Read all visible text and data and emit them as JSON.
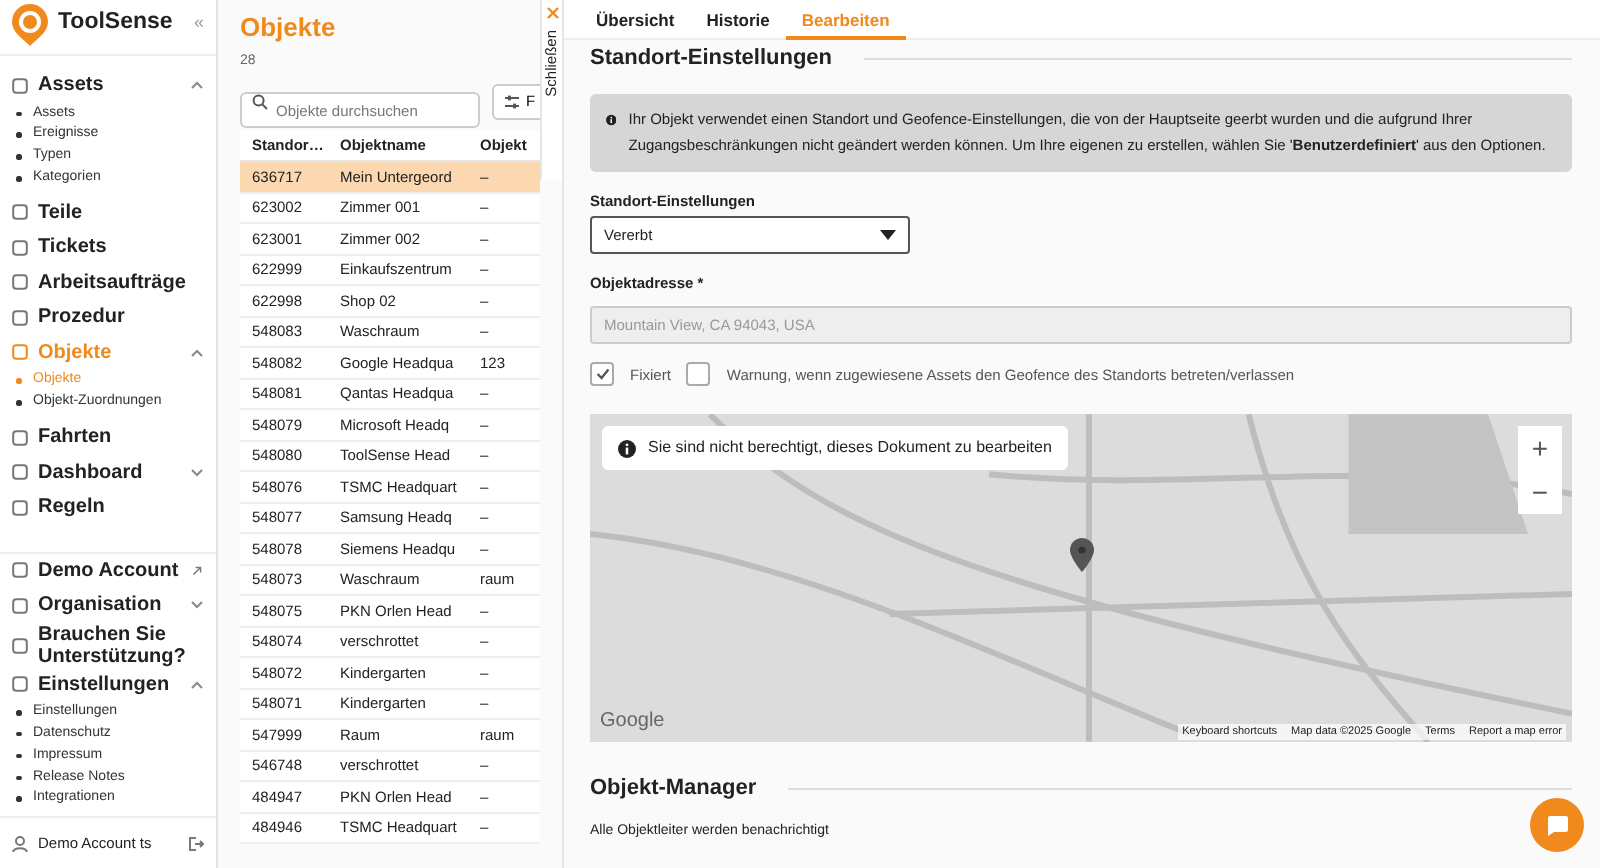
{
  "sidebar": {
    "brand": "ToolSense",
    "collapse_glyph": "«",
    "items": [
      {
        "label": "Assets",
        "selected": false,
        "expanded": true,
        "children": [
          {
            "label": "Assets",
            "selected": false
          },
          {
            "label": "Ereignisse",
            "selected": false
          },
          {
            "label": "Typen",
            "selected": false
          },
          {
            "label": "Kategorien",
            "selected": false
          }
        ]
      },
      {
        "label": "Teile",
        "selected": false
      },
      {
        "label": "Tickets",
        "selected": false
      },
      {
        "label": "Arbeitsaufträge",
        "selected": false
      },
      {
        "label": "Prozedur",
        "selected": false
      },
      {
        "label": "Objekte",
        "selected": true,
        "expanded": true,
        "children": [
          {
            "label": "Objekte",
            "selected": true
          },
          {
            "label": "Objekt-Zuordnungen",
            "selected": false
          }
        ]
      },
      {
        "label": "Fahrten",
        "selected": false
      },
      {
        "label": "Dashboard",
        "selected": false,
        "expanded": false
      },
      {
        "label": "Regeln",
        "selected": false
      }
    ],
    "bottom_items": [
      {
        "label": "Demo Account",
        "selected": false,
        "external": true
      },
      {
        "label": "Organisation",
        "selected": false,
        "expanded": false
      },
      {
        "label": "Brauchen Sie Unterstützung?",
        "selected": false
      },
      {
        "label": "Einstellungen",
        "selected": false,
        "expanded": true,
        "children": [
          {
            "label": "Einstellungen",
            "selected": false
          },
          {
            "label": "Datenschutz",
            "selected": false
          },
          {
            "label": "Impressum",
            "selected": false
          },
          {
            "label": "Release Notes",
            "selected": false
          },
          {
            "label": "Integrationen",
            "selected": false
          }
        ]
      }
    ],
    "user": "Demo Account ts"
  },
  "list_panel": {
    "title": "Objekte",
    "count": "28",
    "search": {
      "placeholder": "Objekte durchsuchen"
    },
    "filter_button": "F",
    "close_tab": "Schließen",
    "table": {
      "columns": [
        "Standor…",
        "Objektname",
        "Objekt"
      ],
      "rows": [
        {
          "cells": [
            "636717",
            "Mein Untergeord",
            "–"
          ],
          "selected": true
        },
        {
          "cells": [
            "623002",
            "Zimmer 001",
            "–"
          ],
          "selected": false
        },
        {
          "cells": [
            "623001",
            "Zimmer 002",
            "–"
          ],
          "selected": false
        },
        {
          "cells": [
            "622999",
            "Einkaufszentrum",
            "–"
          ],
          "selected": false
        },
        {
          "cells": [
            "622998",
            "Shop 02",
            "–"
          ],
          "selected": false
        },
        {
          "cells": [
            "548083",
            "Waschraum",
            "–"
          ],
          "selected": false
        },
        {
          "cells": [
            "548082",
            "Google Headqua",
            "123"
          ],
          "selected": false
        },
        {
          "cells": [
            "548081",
            "Qantas Headqua",
            "–"
          ],
          "selected": false
        },
        {
          "cells": [
            "548079",
            "Microsoft Headq",
            "–"
          ],
          "selected": false
        },
        {
          "cells": [
            "548080",
            "ToolSense Head",
            "–"
          ],
          "selected": false
        },
        {
          "cells": [
            "548076",
            "TSMC Headquart",
            "–"
          ],
          "selected": false
        },
        {
          "cells": [
            "548077",
            "Samsung Headq",
            "–"
          ],
          "selected": false
        },
        {
          "cells": [
            "548078",
            "Siemens Headqu",
            "–"
          ],
          "selected": false
        },
        {
          "cells": [
            "548073",
            "Waschraum",
            "raum"
          ],
          "selected": false
        },
        {
          "cells": [
            "548075",
            "PKN Orlen Head",
            "–"
          ],
          "selected": false
        },
        {
          "cells": [
            "548074",
            "verschrottet",
            "–"
          ],
          "selected": false
        },
        {
          "cells": [
            "548072",
            "Kindergarten",
            "–"
          ],
          "selected": false
        },
        {
          "cells": [
            "548071",
            "Kindergarten",
            "–"
          ],
          "selected": false
        },
        {
          "cells": [
            "547999",
            "Raum",
            "raum"
          ],
          "selected": false
        },
        {
          "cells": [
            "546748",
            "verschrottet",
            "–"
          ],
          "selected": false
        },
        {
          "cells": [
            "484947",
            "PKN Orlen Head",
            "–"
          ],
          "selected": false
        },
        {
          "cells": [
            "484946",
            "TSMC Headquart",
            "–"
          ],
          "selected": false
        }
      ]
    }
  },
  "detail": {
    "tabs": [
      {
        "label": "Übersicht",
        "selected": false
      },
      {
        "label": "Historie",
        "selected": false
      },
      {
        "label": "Bearbeiten",
        "selected": true
      }
    ],
    "section_title": "Standort-Einstellungen",
    "alert": "Ihr Objekt verwendet einen Standort und Geofence-Einstellungen, die von der Hauptseite geerbt wurden und die aufgrund Ihrer Zugangsbeschränkungen nicht geändert werden können. Um Ihre eigenen zu erstellen, wählen Sie '**Benutzerdefiniert**' aus den Optionen.",
    "location_select": {
      "label": "Standort-Einstellungen",
      "value": "Vererbt"
    },
    "address": {
      "label": "Objektadresse *",
      "value": "Mountain View, CA 94043, USA",
      "disabled": true
    },
    "checkboxes": [
      {
        "label": "Fixiert",
        "checked": true
      },
      {
        "label": "Warnung, wenn zugewiesene Assets den Geofence des Standorts betreten/verlassen",
        "checked": false
      }
    ],
    "map": {
      "notice": "Sie sind nicht berechtigt, dieses Dokument zu bearbeiten",
      "zoom_in": "+",
      "zoom_out": "−",
      "logo": "Google",
      "attribution": [
        "Keyboard shortcuts",
        "Map data ©2025 Google",
        "Terms",
        "Report a map error"
      ]
    },
    "manager_title": "Objekt-Manager",
    "manager_note": "Alle Objektleiter werden benachrichtigt"
  }
}
